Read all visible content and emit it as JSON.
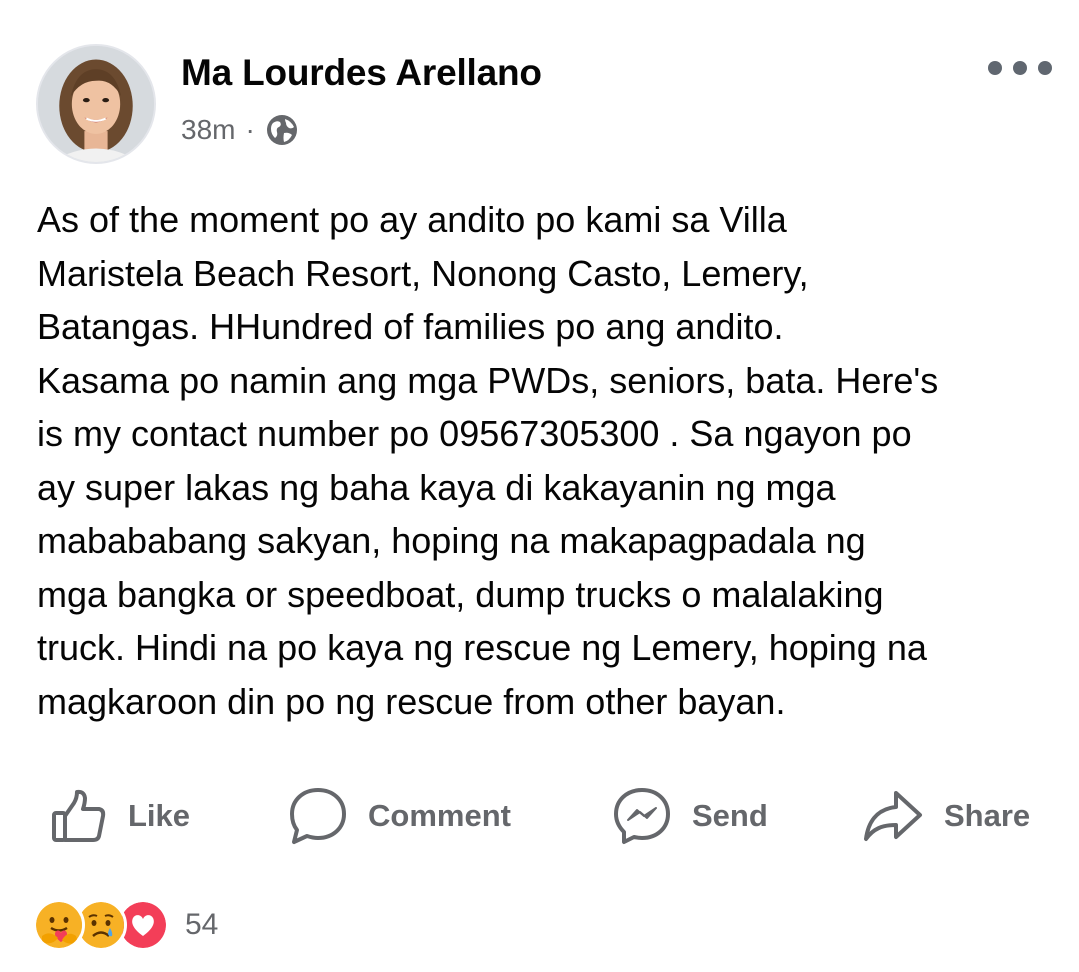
{
  "post": {
    "author": "Ma Lourdes Arellano",
    "time": "38m",
    "separator": "·",
    "privacy_icon": "globe-icon",
    "more_icon": "more-options-icon",
    "body": "As of the moment po ay andito po kami sa Villa\nMaristela Beach Resort, Nonong Casto, Lemery,\nBatangas. HHundred of families po ang andito.\nKasama po namin ang mga PWDs, seniors, bata. Here's\nis my contact number po 09567305300 . Sa ngayon po\nay super lakas ng baha kaya di kakayanin ng mga\nmabababang sakyan, hoping na makapagpadala ng\nmga bangka or speedboat, dump trucks o malalaking\ntruck. Hindi na po kaya ng rescue ng Lemery, hoping na\nmagkaroon din po ng rescue from other bayan."
  },
  "actions": {
    "like": {
      "label": "Like",
      "icon": "thumbs-up-icon"
    },
    "comment": {
      "label": "Comment",
      "icon": "comment-bubble-icon"
    },
    "send": {
      "label": "Send",
      "icon": "messenger-icon"
    },
    "share": {
      "label": "Share",
      "icon": "share-arrow-icon"
    }
  },
  "reactions": {
    "icons": [
      "care-reaction-icon",
      "sad-reaction-icon",
      "love-reaction-icon"
    ],
    "count": "54"
  },
  "colors": {
    "text_primary": "#050505",
    "text_secondary": "#65676b",
    "love_red": "#f33e58",
    "emoji_yellow": "#f7b125"
  }
}
